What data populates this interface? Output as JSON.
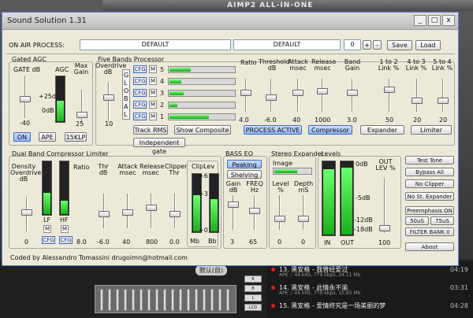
{
  "background": {
    "player_title": "AIMP2 ALL-IN-ONE",
    "pill": "默认(自)",
    "side_buttons": [
      "R",
      "B",
      "L",
      "LCD"
    ],
    "playlist": [
      {
        "num": "13.",
        "title": "黑安格 - 我曾经爱过",
        "sub": "APE :: 44 kHz, 779 kbps, 24.11 Mb",
        "time": "04:19"
      },
      {
        "num": "14.",
        "title": "黑安格 - 此情永不渝",
        "sub": "APE :: 44 kHz, 779 kbps, 15.65 Mb",
        "time": "03:31"
      },
      {
        "num": "15.",
        "title": "黑安格 - 爱情终究是一场美丽的梦",
        "sub": "",
        "time": "04:28"
      }
    ]
  },
  "window": {
    "title": "Sound Solution 1.31",
    "titlebar_buttons": [
      "_",
      "□",
      "x"
    ]
  },
  "top": {
    "on_air_label": "ON AIR PROCESS:",
    "preset_left": "DEFAULT",
    "preset_right": "DEFAULT",
    "preset_num": "0",
    "plus": "+",
    "minus": "-",
    "save": "Save",
    "load": "Load"
  },
  "agc": {
    "group": "Gated AGC",
    "gate_label": "GATE dB",
    "agc_label": "AGC",
    "maxgain_label": "Max Gain",
    "plus25": "+25dB",
    "zero": "0dB",
    "gate_value": "-40",
    "maxgain_value": "25",
    "btn_on": "ON",
    "btn_ape": "APE",
    "btn_15klp": "15KLP",
    "agc_level": 0.45
  },
  "five_band": {
    "group": "Five Bands Processor",
    "overdrive_label": "Overdrive dB",
    "overdrive_value": "10",
    "global_letters": [
      "G",
      "L",
      "O",
      "B",
      "A",
      "L"
    ],
    "cfg": "CFG",
    "m": "M",
    "bands": [
      {
        "num": "5",
        "level": 0.32
      },
      {
        "num": "4",
        "level": 0.18
      },
      {
        "num": "3",
        "level": 0.22
      },
      {
        "num": "2",
        "level": 0.12
      },
      {
        "num": "1",
        "level": 0.6
      }
    ],
    "columns": [
      {
        "label": "Ratio",
        "value": "4.0"
      },
      {
        "label": "Threshold dB",
        "value": "-6.0"
      },
      {
        "label": "Attack msec",
        "value": "40"
      },
      {
        "label": "Release msec",
        "value": "1000"
      },
      {
        "label": "Band Gain",
        "value": "3.0"
      },
      {
        "label": "1 to 2 Link %",
        "value": "50"
      },
      {
        "label": "4 to 3 Link %",
        "value": "20"
      },
      {
        "label": "5 to 4 Link %",
        "value": "20"
      }
    ],
    "track_rms": "Track RMS",
    "show_composite": "Show Composite",
    "process_active": "PROCESS ACTIVE",
    "compressor": "Compressor",
    "expander": "Expander",
    "limiter": "Limiter",
    "independent_gate": "Independent gate"
  },
  "dual_band": {
    "group": "Dual Band Compressor Limiter",
    "density_label": "Density Overdrive dB",
    "density_value": "0",
    "lf": "LF",
    "hf": "HF",
    "m": "M",
    "cfg": "CFG",
    "lf_level": 0.4,
    "hf_level": 0.25,
    "ratio_label": "Ratio",
    "ratio_value": "8.0",
    "thr_label": "Thr dB",
    "thr_value": "-6.0",
    "attack_label": "Attack msec",
    "attack_value": "40",
    "release_label": "Release msec",
    "release_value": "800",
    "clipper_label": "Clipper Thr",
    "clipper_value": "0.0",
    "cliplev_label": "ClipLev",
    "cliplev_scale": [
      "+6",
      "+3",
      "+0"
    ],
    "mb": "Mb",
    "bb": "Bb",
    "mb_level": 0.62,
    "bb_level": 0.55
  },
  "bass_eq": {
    "group": "BASS EQ",
    "peaking": "Peaking",
    "shelving": "Shelving",
    "gain_label": "Gain dB",
    "gain_value": "3",
    "freq_label": "FREQ Hz",
    "freq_value": "65"
  },
  "stereo_expander": {
    "group": "Stereo Expander",
    "image_label": "Image",
    "image_level": 0.6,
    "level_label": "Level %",
    "level_value": "0",
    "depth_label": "Depth mS",
    "depth_value": "0"
  },
  "levels": {
    "group": "Levels",
    "scale": [
      "0dB",
      "-5dB",
      "-12dB",
      "-18dB"
    ],
    "in": "IN",
    "out": "OUT",
    "in_level": 0.88,
    "out_level": 0.9,
    "out_lev_label": "OUT LEV %",
    "out_lev_value": "100"
  },
  "right_panel": {
    "test_tone": "Test Tone",
    "bypass_all": "Bypass All",
    "no_clipper": "No Clipper",
    "no_st_expander": "No St. Expander",
    "preemphasis": "Preemphasis ON",
    "us50": "50uS",
    "us75": "75uS",
    "filter_bank": "FILTER BANK II",
    "about": "About"
  },
  "footer": {
    "credit": "Coded by Alessandro Tomassini drugoimn@hotmail.com"
  }
}
